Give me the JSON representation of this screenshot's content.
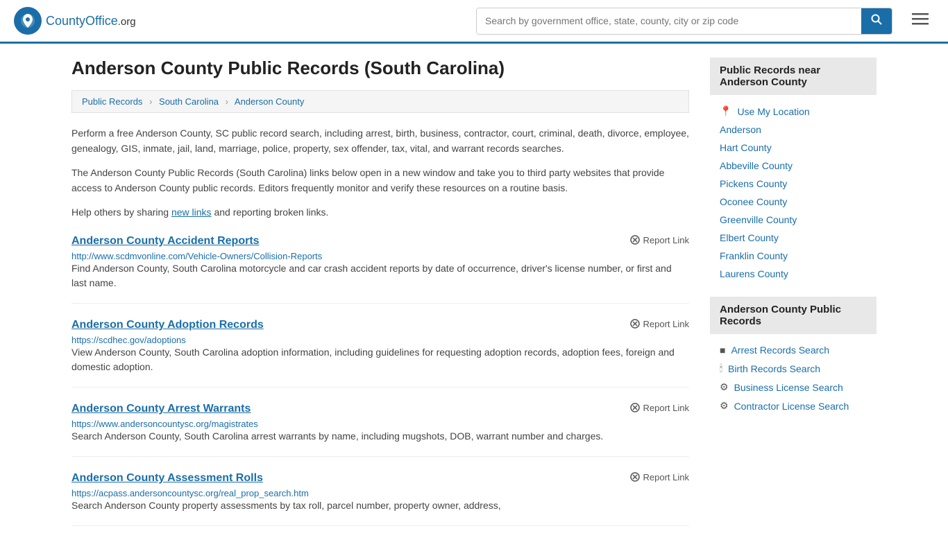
{
  "header": {
    "logo_text": "CountyOffice",
    "logo_suffix": ".org",
    "search_placeholder": "Search by government office, state, county, city or zip code",
    "search_value": ""
  },
  "page": {
    "title": "Anderson County Public Records (South Carolina)"
  },
  "breadcrumb": {
    "items": [
      "Public Records",
      "South Carolina",
      "Anderson County"
    ]
  },
  "descriptions": {
    "intro": "Perform a free Anderson County, SC public record search, including arrest, birth, business, contractor, court, criminal, death, divorce, employee, genealogy, GIS, inmate, jail, land, marriage, police, property, sex offender, tax, vital, and warrant records searches.",
    "editors": "The Anderson County Public Records (South Carolina) links below open in a new window and take you to third party websites that provide access to Anderson County public records. Editors frequently monitor and verify these resources on a routine basis.",
    "share": "Help others by sharing",
    "new_links": "new links",
    "share_end": "and reporting broken links."
  },
  "records": [
    {
      "title": "Anderson County Accident Reports",
      "url": "http://www.scdmvonline.com/Vehicle-Owners/Collision-Reports",
      "desc": "Find Anderson County, South Carolina motorcycle and car crash accident reports by date of occurrence, driver's license number, or first and last name.",
      "report_label": "Report Link"
    },
    {
      "title": "Anderson County Adoption Records",
      "url": "https://scdhec.gov/adoptions",
      "desc": "View Anderson County, South Carolina adoption information, including guidelines for requesting adoption records, adoption fees, foreign and domestic adoption.",
      "report_label": "Report Link"
    },
    {
      "title": "Anderson County Arrest Warrants",
      "url": "https://www.andersoncountysc.org/magistrates",
      "desc": "Search Anderson County, South Carolina arrest warrants by name, including mugshots, DOB, warrant number and charges.",
      "report_label": "Report Link"
    },
    {
      "title": "Anderson County Assessment Rolls",
      "url": "https://acpass.andersoncountysc.org/real_prop_search.htm",
      "desc": "Search Anderson County property assessments by tax roll, parcel number, property owner, address,",
      "report_label": "Report Link"
    }
  ],
  "sidebar": {
    "nearby_title": "Public Records near Anderson County",
    "use_my_location": "Use My Location",
    "nearby_links": [
      "Anderson",
      "Hart County",
      "Abbeville County",
      "Pickens County",
      "Oconee County",
      "Greenville County",
      "Elbert County",
      "Franklin County",
      "Laurens County"
    ],
    "public_records_title": "Anderson County Public Records",
    "public_records_links": [
      {
        "label": "Arrest Records Search",
        "icon": "■"
      },
      {
        "label": "Birth Records Search",
        "icon": "🕯"
      },
      {
        "label": "Business License Search",
        "icon": "⚙"
      },
      {
        "label": "Contractor License Search",
        "icon": "⚙"
      }
    ]
  }
}
